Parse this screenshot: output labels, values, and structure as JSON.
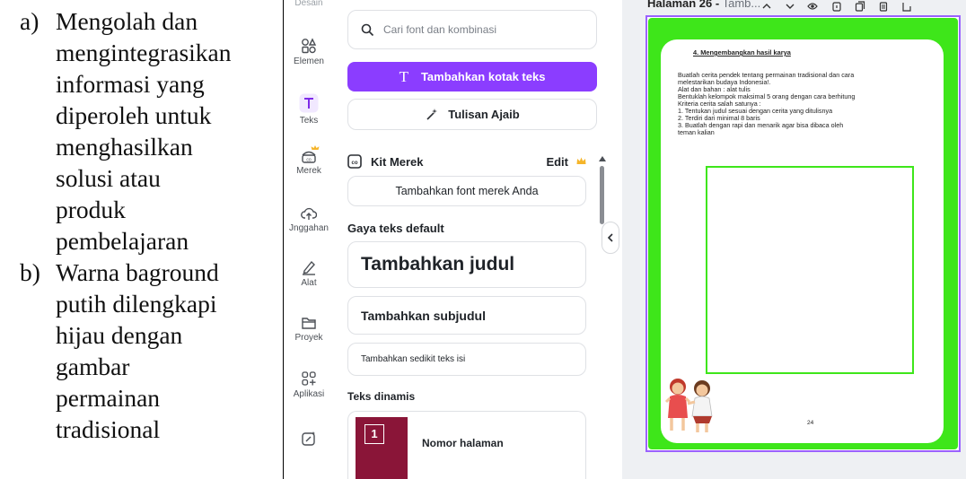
{
  "left_list": [
    {
      "marker": "a)",
      "lines": [
        "Mengolah dan",
        "mengintegrasikan",
        "informasi yang",
        "diperoleh untuk",
        "menghasilkan",
        "solusi atau",
        "produk",
        "pembelajaran"
      ]
    },
    {
      "marker": "b)",
      "lines": [
        "Warna baground",
        "putih dilengkapi",
        "hijau dengan",
        "gambar",
        "permainan",
        "tradisional"
      ]
    }
  ],
  "sidebar": {
    "items": [
      {
        "label": "Desain",
        "icon": "design-icon"
      },
      {
        "label": "Elemen",
        "icon": "elements-icon"
      },
      {
        "label": "Teks",
        "icon": "text-icon",
        "active": true
      },
      {
        "label": "Merek",
        "icon": "brand-icon"
      },
      {
        "label": "Jnggahan",
        "icon": "upload-icon"
      },
      {
        "label": "Alat",
        "icon": "draw-icon"
      },
      {
        "label": "Proyek",
        "icon": "folder-icon"
      },
      {
        "label": "Aplikasi",
        "icon": "apps-icon"
      },
      {
        "label": "",
        "icon": "magic-icon"
      }
    ]
  },
  "panel": {
    "search_placeholder": "Cari font dan kombinasi",
    "add_textbox": "Tambahkan kotak teks",
    "magic_write": "Tulisan Ajaib",
    "brand_kit": "Kit Merek",
    "brand_edit": "Edit",
    "add_brand_font": "Tambahkan font merek Anda",
    "default_styles_heading": "Gaya teks default",
    "add_heading": "Tambahkan judul",
    "add_subheading": "Tambahkan subjudul",
    "add_body": "Tambahkan sedikit teks isi",
    "dynamic_heading": "Teks dinamis",
    "page_number": "Nomor halaman",
    "page_number_tile": "1"
  },
  "topbar": {
    "page_label": "Halaman 26 -",
    "page_title": "Tamb..."
  },
  "document": {
    "heading": "4. Mengembangkan hasil karya",
    "lines": [
      "Buatlah cerita pendek tentang permainan tradisional dan cara",
      "melestarikan budaya Indonesia!.",
      "Alat dan bahan :  alat tulis",
      "Bentuklah kelompok maksimal 5 orang dengan cara berhitung",
      "Kriteria cerita salah satunya :",
      "1. Tentukan judul sesuai dengan cerita yang ditulisnya",
      "2. Terdiri dari minimal 8 baris",
      "3. Buatlah dengan rapi dan menarik agar bisa dibaca oleh",
      "    teman kalian"
    ],
    "page_number": "24"
  },
  "colors": {
    "accent": "#8b3dff",
    "page_green": "#3ee61a",
    "crown": "#f5b52a"
  }
}
